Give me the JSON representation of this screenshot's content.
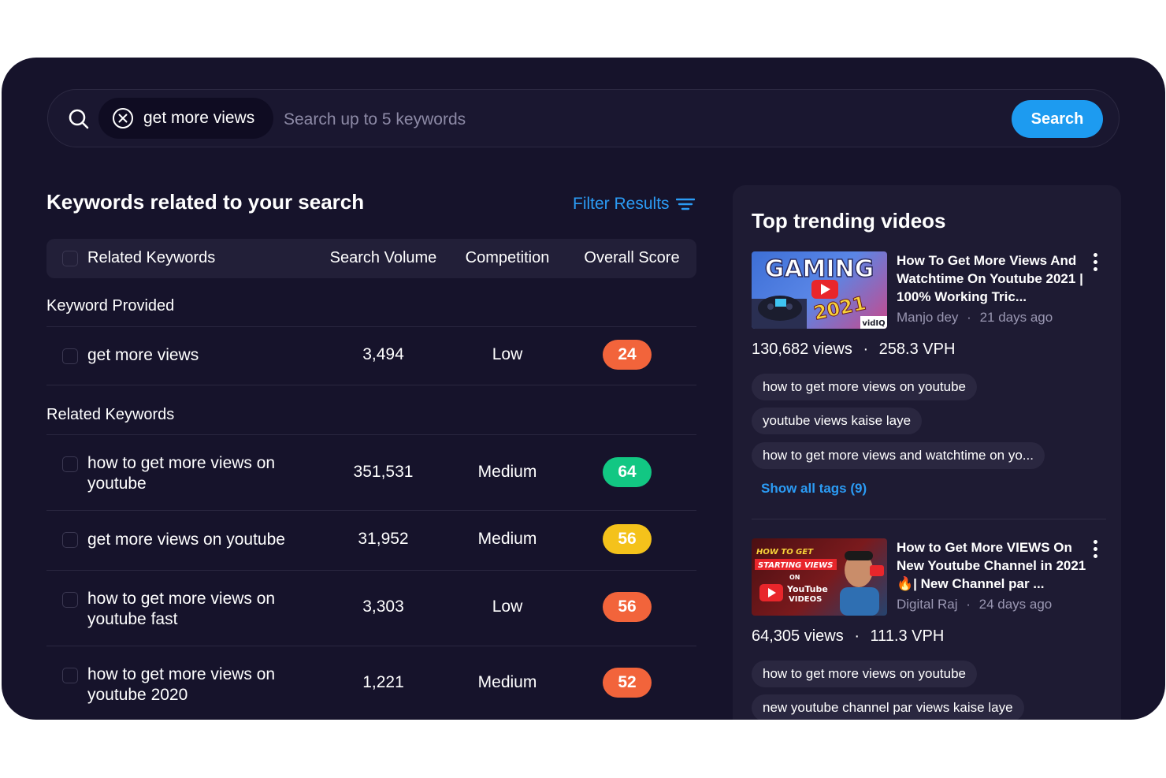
{
  "search": {
    "chip_text": "get more views",
    "placeholder": "Search up to 5 keywords",
    "button_label": "Search"
  },
  "keywords": {
    "title": "Keywords related to your search",
    "filter_label": "Filter Results",
    "headers": {
      "keyword": "Related Keywords",
      "volume": "Search Volume",
      "competition": "Competition",
      "score": "Overall Score"
    },
    "provided_label": "Keyword Provided",
    "provided": [
      {
        "keyword": "get more views",
        "volume": "3,494",
        "competition": "Low",
        "score": "24",
        "score_color": "#f2643b"
      }
    ],
    "related_label": "Related Keywords",
    "related": [
      {
        "keyword": "how to get more views on youtube",
        "volume": "351,531",
        "competition": "Medium",
        "score": "64",
        "score_color": "#12c783"
      },
      {
        "keyword": "get more views on youtube",
        "volume": "31,952",
        "competition": "Medium",
        "score": "56",
        "score_color": "#f4c21b"
      },
      {
        "keyword": "how to get more views on youtube fast",
        "volume": "3,303",
        "competition": "Low",
        "score": "56",
        "score_color": "#f2643b"
      },
      {
        "keyword": "how to get more views on youtube 2020",
        "volume": "1,221",
        "competition": "Medium",
        "score": "52",
        "score_color": "#f2643b"
      }
    ]
  },
  "trending": {
    "title": "Top trending videos",
    "videos": [
      {
        "title": "How To Get More Views And Watchtime On Youtube 2021 | 100% Working Tric...",
        "channel": "Manjo dey",
        "age": "21 days ago",
        "views": "130,682 views",
        "vph": "258.3 VPH",
        "thumb_text": "GAMING",
        "thumb_year": "2021",
        "thumb_badge": "vidIQ",
        "tags": [
          "how to get more views on youtube",
          "youtube views kaise laye",
          "how to get more views and watchtime on yo..."
        ],
        "show_tags": "Show all tags (9)"
      },
      {
        "title": "How to Get More VIEWS On New Youtube Channel in 2021🔥| New Channel par ...",
        "channel": "Digital Raj",
        "age": "24 days ago",
        "views": "64,305 views",
        "vph": "111.3 VPH",
        "thumb_line1": "HOW TO GET",
        "thumb_line2": "STARTING VIEWS",
        "thumb_line3": "ON",
        "thumb_line4": "YouTube",
        "thumb_line5": "VIDEOS",
        "tags": [
          "how to get more views on youtube",
          "new youtube channel par views kaise laye"
        ]
      }
    ]
  },
  "colors": {
    "panel": "#16132b",
    "accent": "#1d9bf0",
    "low_score": "#f2643b",
    "high_score": "#12c783",
    "mid_score": "#f4c21b"
  }
}
